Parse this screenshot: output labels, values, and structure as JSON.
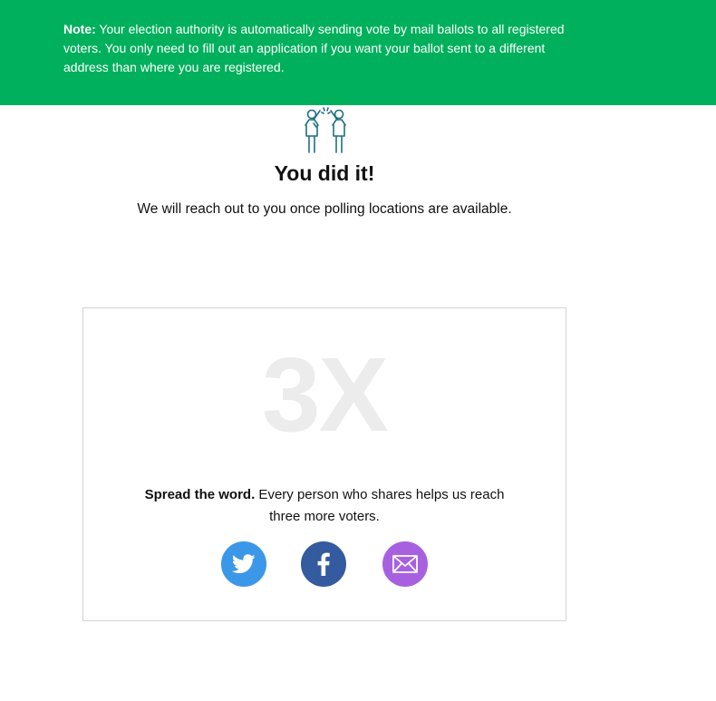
{
  "banner": {
    "label": "Note:",
    "text": " Your election authority is automatically sending vote by mail ballots to all registered voters. You only need to fill out an application if you want your ballot sent to a different address than where you are registered.",
    "color": "#00b05c"
  },
  "hero": {
    "icon": "high-five-icon",
    "title": "You did it!",
    "subtitle": "We will reach out to you once polling locations are available."
  },
  "share": {
    "multiplier": "3X",
    "lead": "Spread the word.",
    "text": " Every person who shares helps us reach three more voters.",
    "buttons": [
      {
        "icon": "twitter-icon",
        "color": "#3b97e8"
      },
      {
        "icon": "facebook-icon",
        "color": "#345a9f"
      },
      {
        "icon": "email-icon",
        "color": "#a761e0"
      }
    ]
  }
}
